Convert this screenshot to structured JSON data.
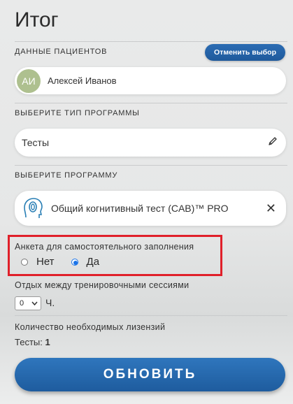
{
  "title": "Итог",
  "patients": {
    "label": "ДАННЫЕ ПАЦИЕНТОВ",
    "cancel_label": "Отменить выбор",
    "avatar_initials": "АИ",
    "name": "Алексей Иванов"
  },
  "program_type": {
    "label": "ВЫБЕРИТЕ ТИП ПРОГРАММЫ",
    "value": "Тесты",
    "edit_icon": "pencil-icon"
  },
  "program": {
    "label": "ВЫБЕРИТЕ ПРОГРАММУ",
    "value": "Общий когнитивный тест (CAB)™ PRO",
    "icon": "head-logo-icon",
    "close_icon": "close-icon"
  },
  "questionnaire": {
    "label": "Анкета для самостоятельного заполнения",
    "options": [
      "Нет",
      "Да"
    ],
    "selected": "Да"
  },
  "rest": {
    "label": "Отдых между тренировочными сессиями",
    "value": "0",
    "unit": "Ч."
  },
  "licenses": {
    "label": "Количество необходимых лизензий",
    "item_label": "Тесты:",
    "count": "1"
  },
  "update_label": "ОБНОВИТЬ",
  "colors": {
    "accent": "#1f5a9c",
    "highlight": "#e0202a",
    "avatar": "#aec08f"
  }
}
